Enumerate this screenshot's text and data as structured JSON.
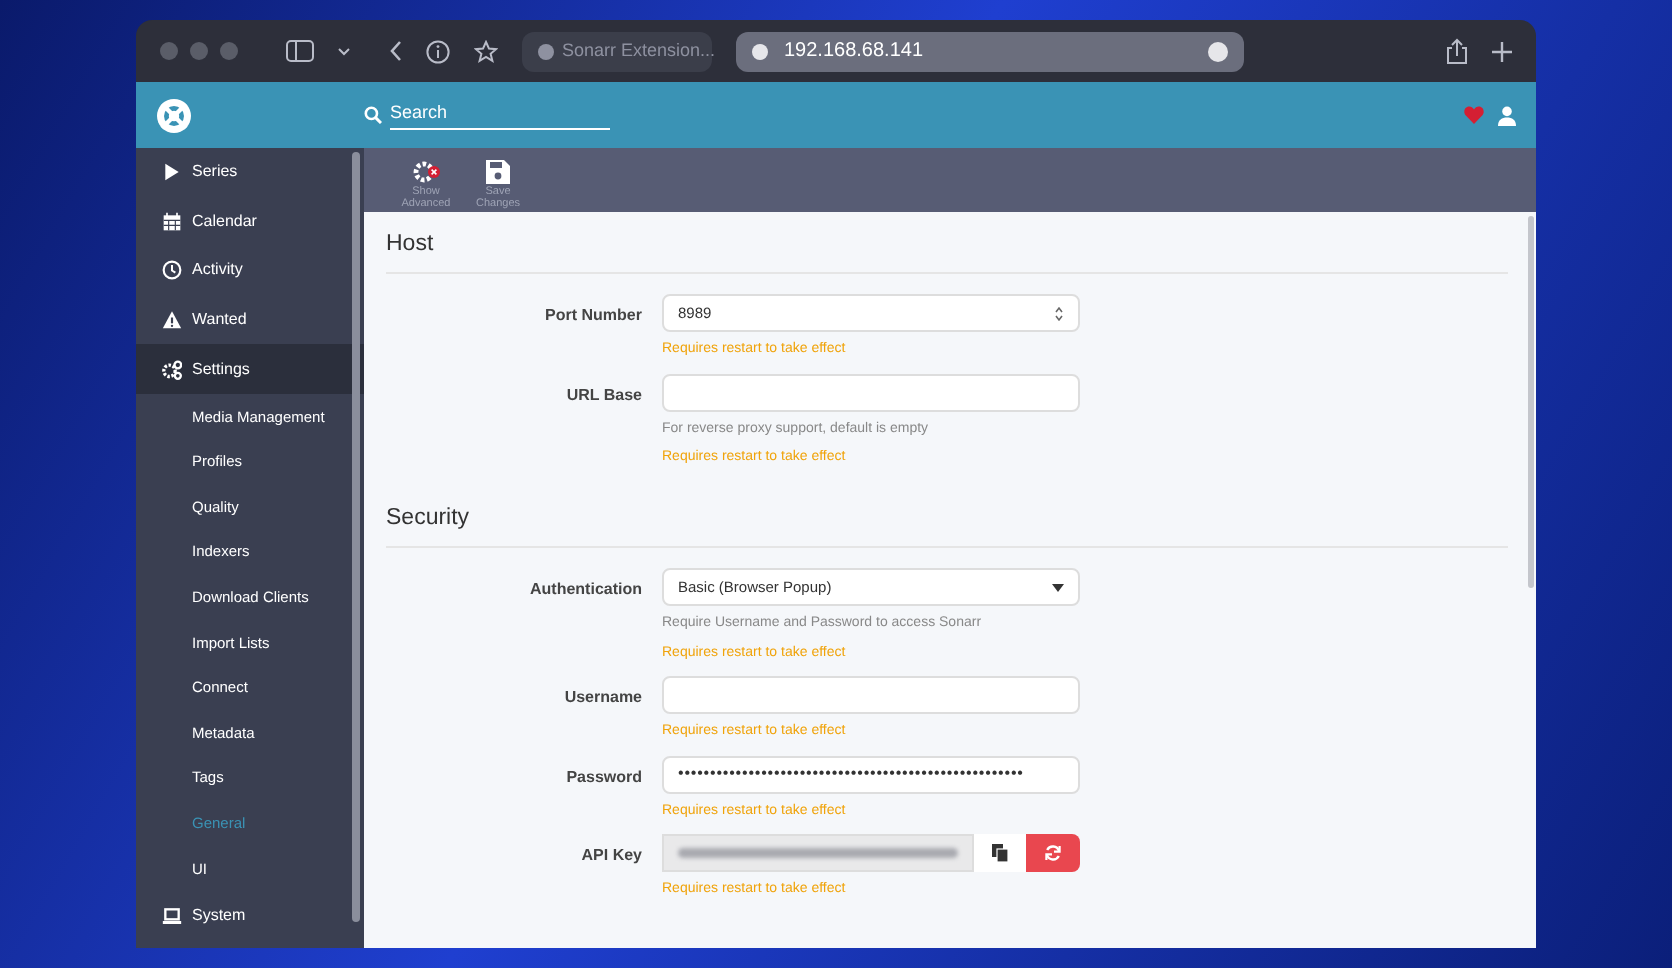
{
  "browser": {
    "tab_title": "Sonarr Extension...",
    "address": "192.168.68.141"
  },
  "header": {
    "search": {
      "placeholder": "Search"
    }
  },
  "sidebar": {
    "items": [
      {
        "label": "Series",
        "selected": false
      },
      {
        "label": "Calendar",
        "selected": false
      },
      {
        "label": "Activity",
        "selected": false
      },
      {
        "label": "Wanted",
        "selected": false
      },
      {
        "label": "Settings",
        "selected": true,
        "children": [
          {
            "label": "Media Management",
            "selected": false
          },
          {
            "label": "Profiles",
            "selected": false
          },
          {
            "label": "Quality",
            "selected": false
          },
          {
            "label": "Indexers",
            "selected": false
          },
          {
            "label": "Download Clients",
            "selected": false
          },
          {
            "label": "Import Lists",
            "selected": false
          },
          {
            "label": "Connect",
            "selected": false
          },
          {
            "label": "Metadata",
            "selected": false
          },
          {
            "label": "Tags",
            "selected": false
          },
          {
            "label": "General",
            "selected": true
          },
          {
            "label": "UI",
            "selected": false
          }
        ]
      },
      {
        "label": "System",
        "selected": false
      }
    ]
  },
  "toolbar": [
    {
      "label": "Show Advanced"
    },
    {
      "label": "Save Changes"
    }
  ],
  "sections": [
    {
      "title": "Host",
      "fields": [
        {
          "label": "Port Number",
          "kind": "number",
          "value": "8989",
          "notes": [
            "Requires restart to take effect"
          ]
        },
        {
          "label": "URL Base",
          "kind": "text",
          "help": "For reverse proxy support, default is empty",
          "notes": [
            "Requires restart to take effect"
          ]
        }
      ]
    },
    {
      "title": "Security",
      "fields": [
        {
          "label": "Authentication",
          "kind": "select",
          "value": "Basic (Browser Popup)",
          "help": "Require Username and Password to access Sonarr",
          "notes": [
            "Requires restart to take effect"
          ]
        },
        {
          "label": "Username",
          "kind": "text",
          "notes": [
            "Requires restart to take effect"
          ]
        },
        {
          "label": "Password",
          "kind": "password",
          "value": "••••••••••••••••••••••••••••••••••••••••••••••••••••••",
          "notes": [
            "Requires restart to take effect"
          ]
        },
        {
          "label": "API Key",
          "kind": "apikey",
          "notes": [
            "Requires restart to take effect"
          ]
        }
      ]
    }
  ]
}
